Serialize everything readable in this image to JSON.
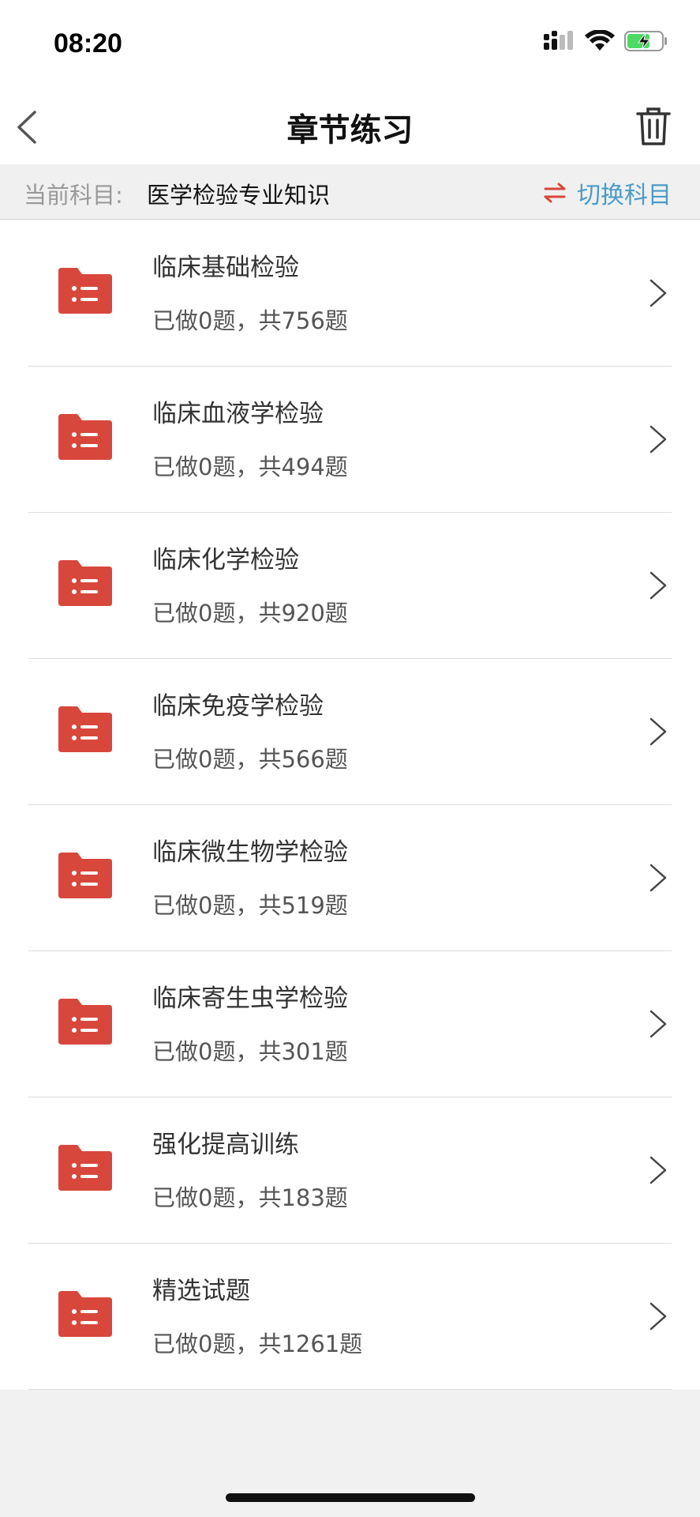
{
  "status": {
    "time": "08:20"
  },
  "nav": {
    "title": "章节练习"
  },
  "subject": {
    "label": "当前科目:",
    "value": "医学检验专业知识",
    "switch_label": "切换科目"
  },
  "colors": {
    "accent_red": "#d8473b",
    "accent_blue": "#4a9bc6"
  },
  "icons": {
    "folder": "folder-list-icon",
    "chevron": "chevron-right-icon",
    "back": "back-arrow-icon",
    "trash": "trash-icon",
    "switch": "switch-arrows-icon"
  },
  "chapters": [
    {
      "title": "临床基础检验",
      "progress": "已做0题，共756题"
    },
    {
      "title": "临床血液学检验",
      "progress": "已做0题，共494题"
    },
    {
      "title": "临床化学检验",
      "progress": "已做0题，共920题"
    },
    {
      "title": "临床免疫学检验",
      "progress": "已做0题，共566题"
    },
    {
      "title": "临床微生物学检验",
      "progress": "已做0题，共519题"
    },
    {
      "title": "临床寄生虫学检验",
      "progress": "已做0题，共301题"
    },
    {
      "title": "强化提高训练",
      "progress": "已做0题，共183题"
    },
    {
      "title": "精选试题",
      "progress": "已做0题，共1261题"
    }
  ]
}
